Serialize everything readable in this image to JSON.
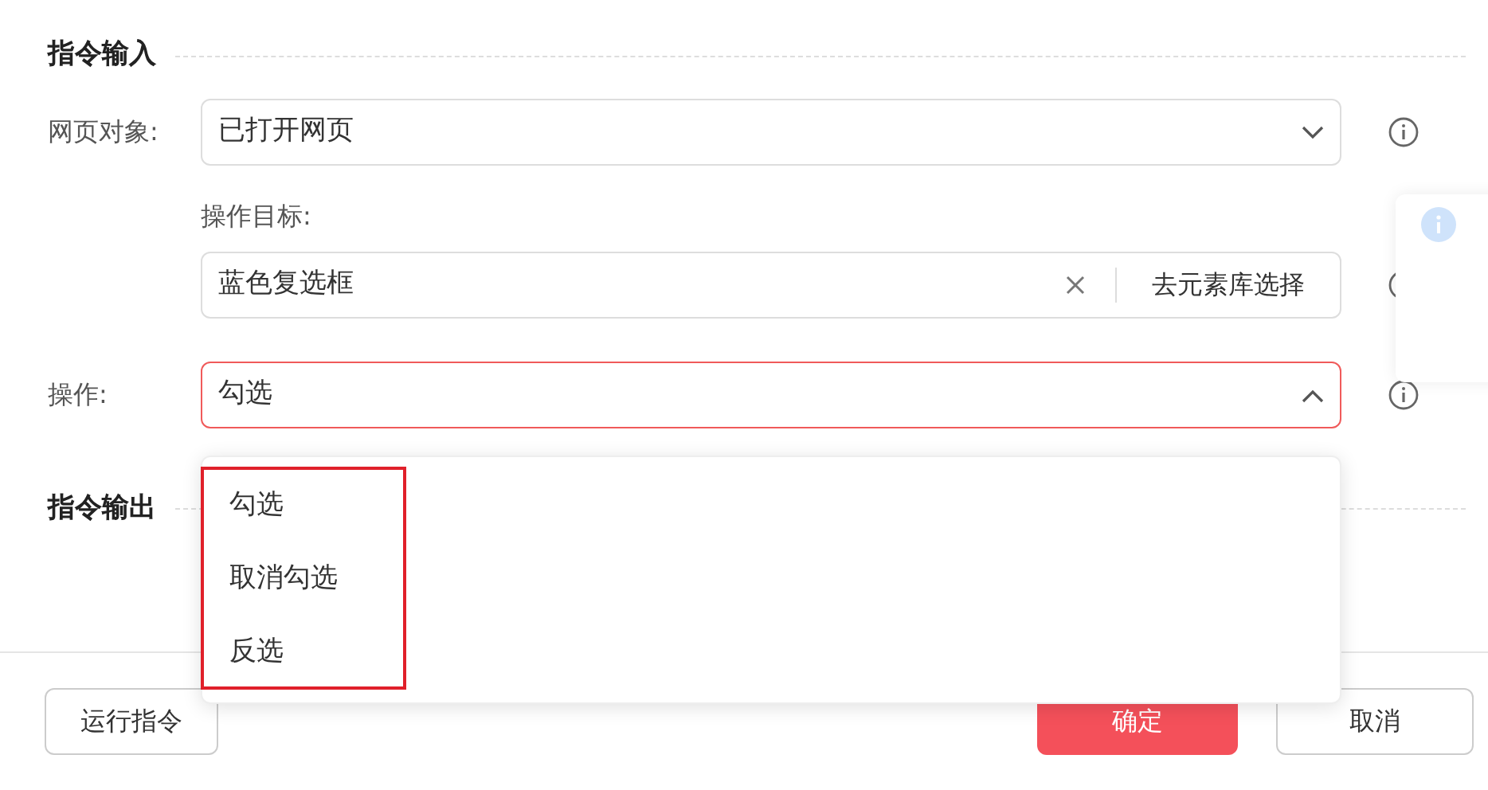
{
  "input_section": {
    "title": "指令输入"
  },
  "page_object": {
    "label": "网页对象:",
    "value": "已打开网页",
    "expanded": false
  },
  "target": {
    "label": "操作目标:",
    "value": "蓝色复选框",
    "browse_button": "去元素库选择"
  },
  "operation": {
    "label": "操作:",
    "value": "勾选",
    "expanded": true,
    "options": [
      "勾选",
      "取消勾选",
      "反选"
    ]
  },
  "output_section": {
    "title": "指令输出"
  },
  "footer": {
    "run_button": "运行指令",
    "confirm_button": "确定",
    "cancel_button": "取消"
  }
}
